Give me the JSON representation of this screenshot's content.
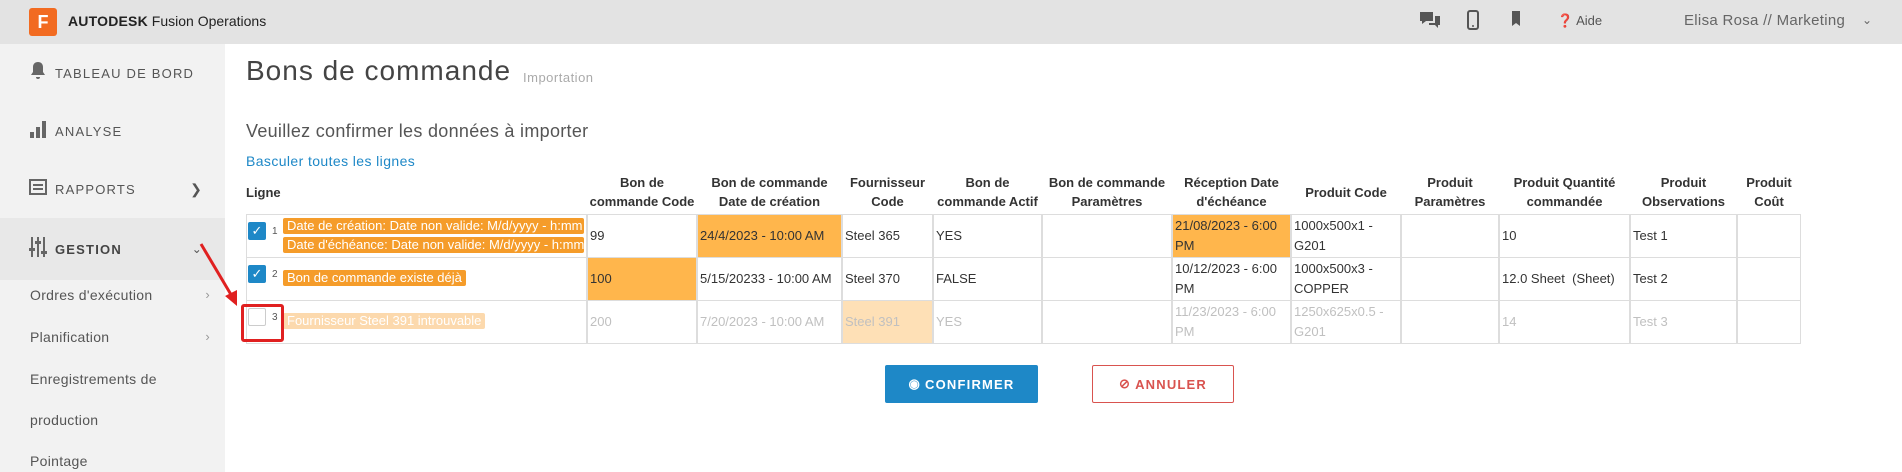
{
  "header": {
    "logo_letter": "F",
    "brand_bold": "AUTODESK",
    "brand_rest": " Fusion Operations",
    "help_label": "Aide",
    "user_label": "Elisa Rosa // Marketing"
  },
  "sidebar": {
    "items": [
      {
        "label": "TABLEAU DE BORD"
      },
      {
        "label": "ANALYSE"
      },
      {
        "label": "RAPPORTS"
      },
      {
        "label": "GESTION"
      }
    ],
    "sub_items": [
      {
        "label": "Ordres d'exécution"
      },
      {
        "label": "Planification"
      },
      {
        "label": "Enregistrements de"
      },
      {
        "label": "production"
      },
      {
        "label": "Pointage"
      }
    ]
  },
  "main": {
    "title": "Bons de commande",
    "subtitle": "Importation",
    "confirm_text": "Veuillez confirmer les données à importer",
    "toggle_link": "Basculer toutes les lignes",
    "confirm_button": "CONFIRMER",
    "cancel_button": "ANNULER"
  },
  "table": {
    "headers": {
      "ligne": "Ligne",
      "code": [
        "Bon de",
        "commande Code"
      ],
      "date_creation": [
        "Bon de commande",
        "Date de création"
      ],
      "fournisseur": [
        "Fournisseur",
        "Code"
      ],
      "actif": [
        "Bon de",
        "commande Actif"
      ],
      "parametres": [
        "Bon de commande",
        "Paramètres"
      ],
      "reception": [
        "Réception Date",
        "d'échéance"
      ],
      "produit_code": [
        "Produit Code"
      ],
      "produit_parametres": [
        "Produit",
        "Paramètres"
      ],
      "quantite": [
        "Produit Quantité",
        "commandée"
      ],
      "observations": [
        "Produit",
        "Observations"
      ],
      "cout": [
        "Produit",
        "Coût"
      ]
    },
    "rows": [
      {
        "num": "1",
        "checked": true,
        "errors": [
          "Date de création: Date non valide: M/d/yyyy - h:mm a",
          "Date d'échéance: Date non valide: M/d/yyyy - h:mm a"
        ],
        "code": "99",
        "date_creation": "24/4/2023 - 10:00 AM",
        "fournisseur": "Steel 365",
        "actif": "YES",
        "parametres": "",
        "reception": [
          "21/08/2023 - 6:00",
          "PM"
        ],
        "produit_code": [
          "1000x500x1 -",
          "G201"
        ],
        "produit_parametres": "",
        "quantite": "10",
        "observations": "Test 1",
        "cout": ""
      },
      {
        "num": "2",
        "checked": true,
        "errors": [
          "Bon de commande existe déjà"
        ],
        "code": "100",
        "date_creation": "5/15/20233 - 10:00 AM",
        "fournisseur": "Steel 370",
        "actif": "FALSE",
        "parametres": "",
        "reception": [
          "10/12/2023 - 6:00",
          "PM"
        ],
        "produit_code": [
          "1000x500x3 -",
          "COPPER"
        ],
        "produit_parametres": "",
        "quantite": "12.0 Sheet  (Sheet)",
        "observations": "Test 2",
        "cout": ""
      },
      {
        "num": "3",
        "checked": false,
        "errors": [
          "Fournisseur Steel 391 introuvable"
        ],
        "code": "200",
        "date_creation": "7/20/2023 - 10:00 AM",
        "fournisseur": "Steel 391",
        "actif": "YES",
        "parametres": "",
        "reception": [
          "11/23/2023 - 6:00",
          "PM"
        ],
        "produit_code": [
          "1250x625x0.5 -",
          "G201"
        ],
        "produit_parametres": "",
        "quantite": "14",
        "observations": "Test 3",
        "cout": ""
      }
    ]
  },
  "colors": {
    "accent": "#1e88c7",
    "error_highlight": "#ffb64c",
    "error_tag": "#f59c2a",
    "cancel": "#d9534f",
    "annotation": "#e02020"
  }
}
